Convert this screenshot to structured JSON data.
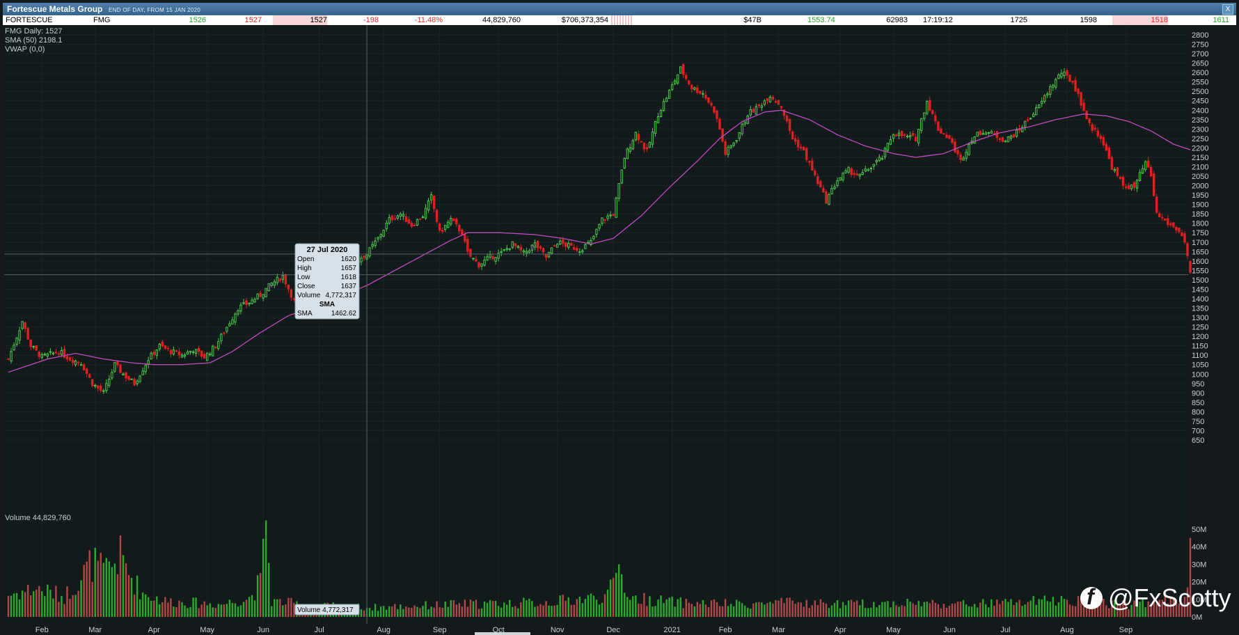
{
  "window": {
    "title": "Fortescue Metals Group",
    "subtitle": "END OF DAY, FROM 15 JAN 2020",
    "close_label": "X"
  },
  "quote": {
    "name": "FORTESCUE",
    "code": "FMG",
    "bid": "1526",
    "offer": "1527",
    "last": "1527",
    "change": "-198",
    "change_pct": "-11.48%",
    "volume": "44,829,760",
    "value": "$706,373,354",
    "mcap": "$47B",
    "vwap": "1553.74",
    "trades": "62983",
    "time": "17:19:12",
    "open": "1725",
    "high": "1598",
    "low": "1518",
    "prev": "1611"
  },
  "legend": {
    "daily": "FMG Daily: 1527",
    "sma": "SMA (50) 2198.1",
    "vwap": "VWAP (0,0)"
  },
  "volume_label": "Volume 44,829,760",
  "tooltip": {
    "date": "27 Jul 2020",
    "open_label": "Open",
    "open": "1620",
    "high_label": "High",
    "high": "1657",
    "low_label": "Low",
    "low": "1618",
    "close_label": "Close",
    "close": "1637",
    "volume_label": "Volume",
    "volume": "4,772,317",
    "sma_heading": "SMA",
    "sma_label": "SMA",
    "sma": "1462.62"
  },
  "volume_tooltip": "Volume 4,772,317",
  "watermark": "@FxScotty",
  "colors": {
    "up": "#4cc94c",
    "down": "#e02020",
    "vol_up": "#2fa82f",
    "vol_down": "#b04848",
    "sma": "#c04cc0",
    "grid": "#1d2426",
    "axis_text": "#c8d0d4"
  },
  "chart_data": {
    "type": "candlestick",
    "title": "Fortescue Metals Group",
    "series": [
      {
        "name": "FMG Daily"
      },
      {
        "name": "SMA (50)"
      }
    ],
    "price_axis": {
      "ylim": [
        650,
        2800
      ],
      "ticks": [
        650,
        700,
        750,
        800,
        850,
        900,
        950,
        1000,
        1050,
        1100,
        1150,
        1200,
        1250,
        1300,
        1350,
        1400,
        1450,
        1500,
        1550,
        1600,
        1650,
        1700,
        1750,
        1800,
        1850,
        1900,
        1950,
        2000,
        2050,
        2100,
        2150,
        2200,
        2250,
        2300,
        2350,
        2400,
        2450,
        2500,
        2550,
        2600,
        2650,
        2700,
        2750,
        2800
      ]
    },
    "volume_axis": {
      "ylim": [
        0,
        50000000
      ],
      "ticks": [
        {
          "v": 0,
          "label": "0M"
        },
        {
          "v": 10000000,
          "label": "10M"
        },
        {
          "v": 20000000,
          "label": "20M"
        },
        {
          "v": 30000000,
          "label": "30M"
        },
        {
          "v": 40000000,
          "label": "40M"
        },
        {
          "v": 50000000,
          "label": "50M"
        }
      ]
    },
    "months": [
      {
        "label": "Feb",
        "i": 12
      },
      {
        "label": "Mar",
        "i": 31
      },
      {
        "label": "Apr",
        "i": 52
      },
      {
        "label": "May",
        "i": 71
      },
      {
        "label": "Jun",
        "i": 91
      },
      {
        "label": "Jul",
        "i": 111
      },
      {
        "label": "Aug",
        "i": 134
      },
      {
        "label": "Sep",
        "i": 154
      },
      {
        "label": "Oct",
        "i": 175
      },
      {
        "label": "Nov",
        "i": 196
      },
      {
        "label": "Dec",
        "i": 216
      },
      {
        "label": "2021",
        "i": 237
      },
      {
        "label": "Feb",
        "i": 256
      },
      {
        "label": "Mar",
        "i": 275
      },
      {
        "label": "Apr",
        "i": 297
      },
      {
        "label": "May",
        "i": 316
      },
      {
        "label": "Jun",
        "i": 336
      },
      {
        "label": "Jul",
        "i": 356
      },
      {
        "label": "Aug",
        "i": 378
      },
      {
        "label": "Sep",
        "i": 399
      }
    ],
    "crosshair": {
      "index": 128,
      "price": 1637,
      "date": "27 Jul 2020"
    },
    "last_price": 1527,
    "close_anchors": [
      [
        0,
        1080
      ],
      [
        5,
        1280
      ],
      [
        8,
        1150
      ],
      [
        12,
        1090
      ],
      [
        18,
        1120
      ],
      [
        22,
        1080
      ],
      [
        26,
        1060
      ],
      [
        30,
        950
      ],
      [
        34,
        900
      ],
      [
        38,
        1050
      ],
      [
        41,
        1000
      ],
      [
        45,
        950
      ],
      [
        50,
        1080
      ],
      [
        54,
        1150
      ],
      [
        58,
        1120
      ],
      [
        62,
        1100
      ],
      [
        66,
        1130
      ],
      [
        70,
        1090
      ],
      [
        74,
        1150
      ],
      [
        78,
        1250
      ],
      [
        82,
        1350
      ],
      [
        86,
        1380
      ],
      [
        90,
        1420
      ],
      [
        94,
        1480
      ],
      [
        98,
        1520
      ],
      [
        102,
        1390
      ],
      [
        106,
        1400
      ],
      [
        110,
        1380
      ],
      [
        114,
        1430
      ],
      [
        118,
        1500
      ],
      [
        122,
        1560
      ],
      [
        126,
        1620
      ],
      [
        128,
        1637
      ],
      [
        132,
        1720
      ],
      [
        136,
        1820
      ],
      [
        140,
        1850
      ],
      [
        144,
        1790
      ],
      [
        148,
        1840
      ],
      [
        151,
        1940
      ],
      [
        154,
        1750
      ],
      [
        158,
        1820
      ],
      [
        162,
        1750
      ],
      [
        164,
        1640
      ],
      [
        168,
        1580
      ],
      [
        172,
        1620
      ],
      [
        176,
        1640
      ],
      [
        180,
        1690
      ],
      [
        184,
        1640
      ],
      [
        188,
        1690
      ],
      [
        192,
        1620
      ],
      [
        196,
        1700
      ],
      [
        200,
        1680
      ],
      [
        204,
        1660
      ],
      [
        208,
        1700
      ],
      [
        212,
        1820
      ],
      [
        216,
        1850
      ],
      [
        218,
        2000
      ],
      [
        220,
        2150
      ],
      [
        224,
        2280
      ],
      [
        228,
        2180
      ],
      [
        232,
        2380
      ],
      [
        236,
        2500
      ],
      [
        240,
        2620
      ],
      [
        244,
        2520
      ],
      [
        248,
        2490
      ],
      [
        252,
        2400
      ],
      [
        254,
        2300
      ],
      [
        256,
        2170
      ],
      [
        260,
        2250
      ],
      [
        264,
        2380
      ],
      [
        268,
        2420
      ],
      [
        272,
        2480
      ],
      [
        276,
        2420
      ],
      [
        280,
        2250
      ],
      [
        284,
        2180
      ],
      [
        288,
        2050
      ],
      [
        292,
        1920
      ],
      [
        296,
        2030
      ],
      [
        300,
        2080
      ],
      [
        304,
        2050
      ],
      [
        308,
        2100
      ],
      [
        312,
        2150
      ],
      [
        316,
        2280
      ],
      [
        320,
        2260
      ],
      [
        324,
        2250
      ],
      [
        328,
        2450
      ],
      [
        332,
        2300
      ],
      [
        336,
        2250
      ],
      [
        340,
        2130
      ],
      [
        344,
        2250
      ],
      [
        348,
        2290
      ],
      [
        352,
        2270
      ],
      [
        356,
        2240
      ],
      [
        360,
        2280
      ],
      [
        364,
        2350
      ],
      [
        368,
        2420
      ],
      [
        372,
        2520
      ],
      [
        376,
        2600
      ],
      [
        380,
        2550
      ],
      [
        382,
        2480
      ],
      [
        386,
        2320
      ],
      [
        390,
        2260
      ],
      [
        394,
        2100
      ],
      [
        398,
        2000
      ],
      [
        402,
        1990
      ],
      [
        406,
        2120
      ],
      [
        408,
        2050
      ],
      [
        410,
        1850
      ],
      [
        414,
        1800
      ],
      [
        418,
        1760
      ],
      [
        420,
        1700
      ],
      [
        422,
        1527
      ]
    ],
    "sma_anchors": [
      [
        0,
        1010
      ],
      [
        14,
        1080
      ],
      [
        24,
        1110
      ],
      [
        34,
        1080
      ],
      [
        44,
        1060
      ],
      [
        52,
        1050
      ],
      [
        62,
        1050
      ],
      [
        72,
        1060
      ],
      [
        80,
        1120
      ],
      [
        90,
        1220
      ],
      [
        100,
        1310
      ],
      [
        110,
        1360
      ],
      [
        118,
        1410
      ],
      [
        128,
        1470
      ],
      [
        138,
        1550
      ],
      [
        148,
        1630
      ],
      [
        158,
        1710
      ],
      [
        164,
        1750
      ],
      [
        176,
        1750
      ],
      [
        188,
        1740
      ],
      [
        198,
        1720
      ],
      [
        208,
        1690
      ],
      [
        216,
        1720
      ],
      [
        226,
        1840
      ],
      [
        236,
        1990
      ],
      [
        246,
        2130
      ],
      [
        254,
        2250
      ],
      [
        262,
        2340
      ],
      [
        270,
        2390
      ],
      [
        276,
        2400
      ],
      [
        286,
        2350
      ],
      [
        296,
        2270
      ],
      [
        306,
        2210
      ],
      [
        316,
        2170
      ],
      [
        324,
        2150
      ],
      [
        334,
        2170
      ],
      [
        344,
        2230
      ],
      [
        354,
        2280
      ],
      [
        364,
        2310
      ],
      [
        374,
        2350
      ],
      [
        384,
        2380
      ],
      [
        392,
        2370
      ],
      [
        400,
        2340
      ],
      [
        408,
        2290
      ],
      [
        416,
        2220
      ],
      [
        422,
        2190
      ]
    ],
    "volume_anchors": [
      [
        0,
        14000000
      ],
      [
        10,
        18000000
      ],
      [
        20,
        13000000
      ],
      [
        26,
        25000000
      ],
      [
        30,
        35000000
      ],
      [
        34,
        28000000
      ],
      [
        40,
        38000000
      ],
      [
        44,
        25000000
      ],
      [
        48,
        15000000
      ],
      [
        56,
        10000000
      ],
      [
        66,
        9000000
      ],
      [
        76,
        8000000
      ],
      [
        86,
        12000000
      ],
      [
        90,
        22000000
      ],
      [
        92,
        55000000
      ],
      [
        94,
        10000000
      ],
      [
        110,
        7000000
      ],
      [
        130,
        6000000
      ],
      [
        160,
        8000000
      ],
      [
        190,
        9000000
      ],
      [
        214,
        13000000
      ],
      [
        218,
        30000000
      ],
      [
        222,
        12000000
      ],
      [
        240,
        9000000
      ],
      [
        260,
        8000000
      ],
      [
        280,
        9000000
      ],
      [
        300,
        8000000
      ],
      [
        320,
        9000000
      ],
      [
        340,
        8000000
      ],
      [
        360,
        9000000
      ],
      [
        380,
        11000000
      ],
      [
        400,
        8000000
      ],
      [
        420,
        12000000
      ],
      [
        422,
        45000000
      ]
    ],
    "n_bars": 423
  }
}
